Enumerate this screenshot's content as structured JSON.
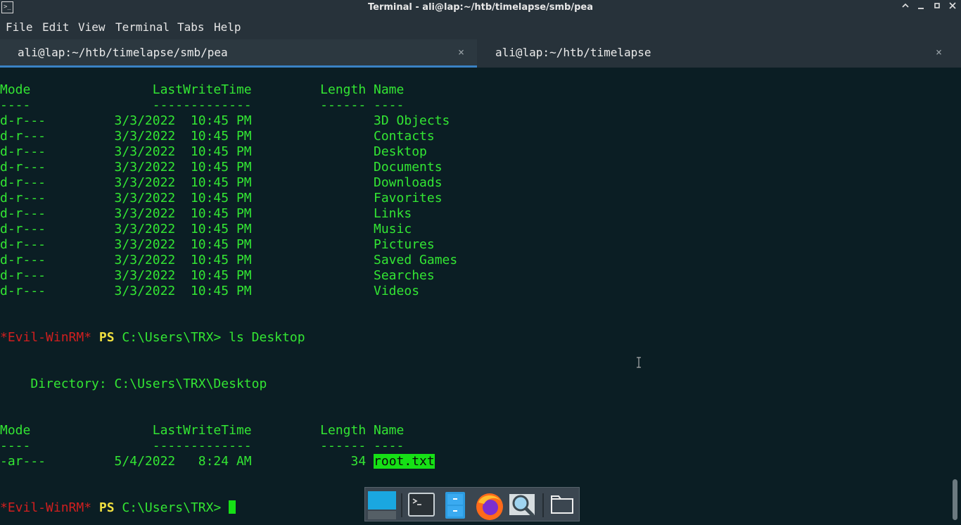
{
  "window": {
    "title": "Terminal - ali@lap:~/htb/timelapse/smb/pea",
    "controls": [
      "chevron-up-icon",
      "minimize-icon",
      "maximize-icon",
      "close-icon"
    ]
  },
  "menu": [
    "File",
    "Edit",
    "View",
    "Terminal",
    "Tabs",
    "Help"
  ],
  "tabs": [
    {
      "label": "ali@lap:~/htb/timelapse/smb/pea",
      "active": true,
      "close": "×"
    },
    {
      "label": "ali@lap:~/htb/timelapse",
      "active": false,
      "close": "×"
    }
  ],
  "terminal": {
    "header1": {
      "cols": "Mode                LastWriteTime         Length Name",
      "dashes": "----                -------------         ------ ----"
    },
    "rows1": [
      "d-r---         3/3/2022  10:45 PM                3D Objects",
      "d-r---         3/3/2022  10:45 PM                Contacts",
      "d-r---         3/3/2022  10:45 PM                Desktop",
      "d-r---         3/3/2022  10:45 PM                Documents",
      "d-r---         3/3/2022  10:45 PM                Downloads",
      "d-r---         3/3/2022  10:45 PM                Favorites",
      "d-r---         3/3/2022  10:45 PM                Links",
      "d-r---         3/3/2022  10:45 PM                Music",
      "d-r---         3/3/2022  10:45 PM                Pictures",
      "d-r---         3/3/2022  10:45 PM                Saved Games",
      "d-r---         3/3/2022  10:45 PM                Searches",
      "d-r---         3/3/2022  10:45 PM                Videos"
    ],
    "prompt": {
      "tag": "*Evil-WinRM*",
      "ps": "PS",
      "path": "C:\\Users\\TRX>",
      "command": "ls Desktop"
    },
    "directory_line": "    Directory: C:\\Users\\TRX\\Desktop",
    "header2": {
      "cols": "Mode                LastWriteTime         Length Name",
      "dashes": "----                -------------         ------ ----"
    },
    "row2_prefix": "-ar---         5/4/2022   8:24 AM             34 ",
    "row2_name": "root.txt",
    "prompt2": {
      "tag": "*Evil-WinRM*",
      "ps": "PS",
      "path": "C:\\Users\\TRX>"
    }
  },
  "dock": [
    "show-desktop-icon",
    "terminal-icon",
    "file-cabinet-icon",
    "firefox-icon",
    "magnifier-icon",
    "folder-icon"
  ]
}
